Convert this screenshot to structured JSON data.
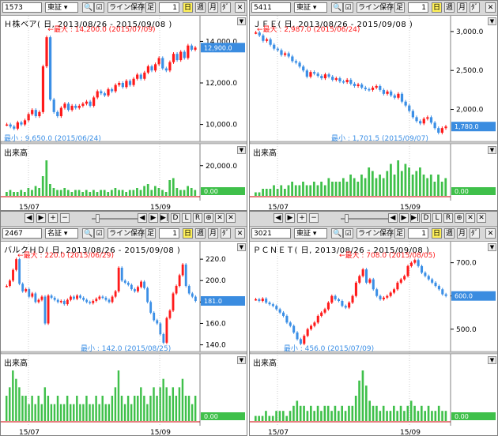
{
  "common": {
    "exchange_tse": "東証",
    "exchange_nse": "名証",
    "save_label": "ライン保存",
    "ashi_label": "足",
    "num1": "1",
    "day_label": "日",
    "week_label": "週",
    "month_label": "月",
    "extra_label": "ﾀﾞ",
    "volume_label": "出来高",
    "vol_zero": "0.00",
    "xticks": [
      "15/07",
      "15/09"
    ],
    "ctrl_letters": [
      "D",
      "L",
      "R"
    ],
    "up_color": "#ff1a1a",
    "down_color": "#3b8fe6",
    "vol_color": "#3fc04a"
  },
  "panels": [
    {
      "code": "1573",
      "exchange": "東証",
      "title": "Ｈ株ベア( 日, 2013/08/26 - 2015/09/08 )",
      "max_label": "最大 : 14,200.0 (2015/07/09)",
      "min_label": "最小 : 9,650.0 (2015/06/24)",
      "yticks": [
        "14,000.0",
        "12,000.0",
        "10,000.0"
      ],
      "ytick_values": [
        14000,
        12000,
        10000
      ],
      "last_badge": "12,900.0",
      "vol_tick": "20,000.0",
      "ymin": 9300,
      "ymax": 14700
    },
    {
      "code": "5411",
      "exchange": "東証",
      "title": "ＪＦＥ( 日, 2013/08/26 - 2015/09/08 )",
      "max_label": "最大 : 2,987.0 (2015/06/24)",
      "min_label": "最小 : 1,701.5 (2015/09/07)",
      "yticks": [
        "3,000.0",
        "2,500.0",
        "2,000.0"
      ],
      "ytick_values": [
        3000,
        2500,
        2000
      ],
      "last_badge": "1,780.0",
      "vol_tick": "",
      "ymin": 1620,
      "ymax": 3060
    },
    {
      "code": "2467",
      "exchange": "名証",
      "title": "バルクＨＤ( 日, 2013/08/26 - 2015/09/08 )",
      "max_label": "最大 : 220.0 (2015/06/29)",
      "min_label": "最小 : 142.0 (2015/08/25)",
      "yticks": [
        "220.0",
        "200.0",
        "180.0",
        "160.0",
        "140.0"
      ],
      "ytick_values": [
        220,
        200,
        180,
        160,
        140
      ],
      "last_badge": "181.0",
      "vol_tick": "",
      "ymin": 136,
      "ymax": 226
    },
    {
      "code": "3021",
      "exchange": "東証",
      "title": "ＰＣＮＥＴ( 日, 2013/08/26 - 2015/09/08 )",
      "max_label": "最大 : 708.0 (2015/08/05)",
      "min_label": "最小 : 456.0 (2015/07/09)",
      "yticks": [
        "700.0",
        "600.0",
        "500.0"
      ],
      "ytick_values": [
        700,
        600,
        500
      ],
      "last_badge": "600.0",
      "vol_tick": "",
      "ymin": 440,
      "ymax": 730
    }
  ],
  "chart_data": [
    {
      "type": "candlestick",
      "title": "Ｈ株ベア( 日, 2013/08/26 - 2015/09/08 )",
      "ylim": [
        9300,
        14700
      ],
      "series": [
        {
          "name": "close",
          "values": [
            10000,
            9900,
            9800,
            10100,
            10000,
            10200,
            10500,
            10700,
            10400,
            10600,
            12800,
            14200,
            11200,
            10600,
            10400,
            10800,
            11000,
            10700,
            10900,
            10800,
            10900,
            11000,
            11100,
            10900,
            11300,
            11600,
            11500,
            11400,
            11700,
            11600,
            11900,
            12000,
            11800,
            12100,
            11900,
            12200,
            12400,
            12200,
            12500,
            12800,
            12600,
            12900,
            13200,
            12700,
            12600,
            13000,
            13400,
            13100,
            13500,
            13200,
            13800,
            13600,
            13700
          ]
        }
      ],
      "volume": [
        2,
        3,
        2,
        2,
        3,
        2,
        4,
        3,
        5,
        4,
        10,
        18,
        6,
        4,
        3,
        3,
        4,
        3,
        2,
        3,
        3,
        2,
        3,
        2,
        3,
        2,
        3,
        3,
        2,
        3,
        4,
        3,
        3,
        2,
        3,
        3,
        4,
        3,
        5,
        6,
        3,
        5,
        4,
        3,
        2,
        8,
        9,
        4,
        3,
        3,
        5,
        4,
        3
      ]
    },
    {
      "type": "candlestick",
      "title": "ＪＦＥ( 日, 2013/08/26 - 2015/09/08 )",
      "ylim": [
        1620,
        3060
      ],
      "series": [
        {
          "name": "close",
          "values": [
            2987,
            2950,
            2880,
            2900,
            2830,
            2780,
            2760,
            2700,
            2720,
            2680,
            2620,
            2600,
            2550,
            2500,
            2420,
            2480,
            2460,
            2430,
            2400,
            2450,
            2420,
            2380,
            2400,
            2360,
            2350,
            2380,
            2330,
            2300,
            2320,
            2280,
            2260,
            2250,
            2280,
            2300,
            2250,
            2200,
            2230,
            2180,
            2150,
            2200,
            2100,
            2050,
            1980,
            1900,
            1850,
            1820,
            1880,
            1900,
            1830,
            1760,
            1701,
            1760,
            1780
          ]
        }
      ],
      "volume": [
        1,
        1,
        2,
        2,
        2,
        3,
        2,
        3,
        2,
        3,
        4,
        3,
        3,
        4,
        3,
        3,
        4,
        3,
        4,
        3,
        5,
        4,
        4,
        4,
        5,
        4,
        6,
        5,
        4,
        6,
        5,
        8,
        7,
        5,
        6,
        5,
        7,
        9,
        6,
        10,
        7,
        9,
        8,
        6,
        7,
        8,
        6,
        5,
        6,
        4,
        6,
        4,
        5
      ]
    },
    {
      "type": "candlestick",
      "title": "バルクＨＤ( 日, 2013/08/26 - 2015/09/08 )",
      "ylim": [
        136,
        226
      ],
      "series": [
        {
          "name": "close",
          "values": [
            195,
            200,
            210,
            220,
            197,
            190,
            192,
            185,
            188,
            180,
            182,
            185,
            160,
            186,
            184,
            182,
            180,
            181,
            178,
            182,
            185,
            183,
            186,
            184,
            182,
            180,
            179,
            181,
            183,
            185,
            184,
            182,
            180,
            185,
            190,
            212,
            200,
            198,
            196,
            192,
            190,
            194,
            199,
            193,
            180,
            170,
            163,
            160,
            150,
            142,
            165,
            172,
            188,
            195,
            205,
            215,
            195,
            188,
            185,
            181
          ]
        }
      ],
      "volume": [
        3,
        4,
        6,
        5,
        4,
        3,
        3,
        2,
        3,
        2,
        3,
        2,
        4,
        3,
        2,
        2,
        3,
        2,
        2,
        3,
        2,
        2,
        3,
        2,
        2,
        3,
        2,
        2,
        3,
        2,
        3,
        2,
        2,
        3,
        4,
        6,
        3,
        2,
        3,
        2,
        3,
        3,
        4,
        3,
        2,
        3,
        4,
        3,
        4,
        5,
        4,
        3,
        4,
        3,
        4,
        5,
        3,
        3,
        2,
        3
      ]
    },
    {
      "type": "candlestick",
      "title": "ＰＣＮＥＴ( 日, 2013/08/26 - 2015/09/08 )",
      "ylim": [
        440,
        730
      ],
      "series": [
        {
          "name": "close",
          "values": [
            590,
            585,
            592,
            580,
            575,
            570,
            560,
            550,
            540,
            520,
            510,
            490,
            470,
            456,
            480,
            500,
            510,
            520,
            540,
            550,
            560,
            580,
            600,
            590,
            585,
            570,
            565,
            580,
            600,
            640,
            660,
            680,
            640,
            650,
            620,
            600,
            590,
            595,
            600,
            610,
            620,
            640,
            650,
            660,
            690,
            700,
            708,
            690,
            670,
            660,
            650,
            640,
            630,
            620,
            605,
            600
          ]
        }
      ],
      "volume": [
        1,
        1,
        1,
        2,
        1,
        1,
        2,
        2,
        2,
        1,
        2,
        3,
        4,
        3,
        3,
        2,
        3,
        2,
        3,
        2,
        3,
        3,
        2,
        3,
        2,
        3,
        2,
        3,
        3,
        5,
        8,
        10,
        7,
        4,
        3,
        3,
        2,
        3,
        2,
        2,
        3,
        2,
        3,
        2,
        3,
        4,
        3,
        2,
        3,
        2,
        3,
        2,
        2,
        3,
        2,
        2
      ]
    }
  ]
}
